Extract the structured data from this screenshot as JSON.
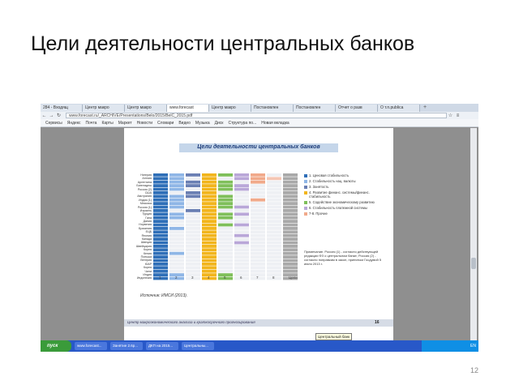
{
  "slide": {
    "title": "Цели деятельности центральных банков",
    "number": "12"
  },
  "browser": {
    "tabs": [
      "284 - Входящ",
      "Центр макро",
      "Центр макро",
      "www.forecast",
      "Центр макро",
      "Постановлен",
      "Постановлен",
      "Отчет о разв",
      "О т.п.publica"
    ],
    "active_tab": 3,
    "address": "www.forecast.ru/_ARCHIVE/Presentations/Belo/2015/BelC_2015.pdf",
    "bookmarks": [
      "Сервисы",
      "Яндекс",
      "Почта",
      "Карты",
      "Маркет",
      "Новости",
      "Словари",
      "Видео",
      "Музыка",
      "Диск",
      "Структура по...",
      "Новая вкладка"
    ]
  },
  "pdf": {
    "heading": "Цели деятельности центральных банков",
    "countries": [
      "Нигерия",
      "Англия",
      "Аргентина",
      "Бангладеш",
      "Россия (2)",
      "США",
      "Австралия",
      "Индия (1)",
      "Мексика",
      "Россия (1)",
      "Израиль",
      "Турция",
      "Гана",
      "Дания",
      "Норвегия",
      "Бразилия",
      "ЕЦБ",
      "Япония",
      "Канада",
      "Швеция",
      "Швейцария",
      "Корея",
      "Кения",
      "Польша",
      "Венгрия",
      "ЮАР",
      "Корея",
      "Чили",
      "Индия",
      "Индонезия"
    ],
    "column_numbers": [
      "1",
      "2",
      "3",
      "4",
      "5",
      "6",
      "7",
      "8",
      "Цели"
    ],
    "legend": [
      {
        "label": "1. Ценовая стабильность",
        "color": "#2f6fb8"
      },
      {
        "label": "2. Стабильность нац. валюты",
        "color": "#8fb6e6"
      },
      {
        "label": "3. Занятость",
        "color": "#6a7fb3"
      },
      {
        "label": "4. Развитие финанс. системы/финанс. стабильность",
        "color": "#f2b51c"
      },
      {
        "label": "5. Содействие экономическому развитию",
        "color": "#7fbf5a"
      },
      {
        "label": "6. Стабильность платежной системы",
        "color": "#b9a7d8"
      },
      {
        "label": "7-8. Прочие",
        "color": "#f1a98a"
      }
    ],
    "note": "Примечание. Россия (1) - согласно действующей редакции ФЗ о центральном банке; Россия (2) - согласно поправкам в закон, принятым Госдумой 5 июля 2013 г.",
    "source": "Источник: ИМСИ (2013).",
    "footer": "Центр макроэкономического анализа и краткосрочного прогнозирования",
    "page": "16",
    "tooltip": "Центральный банк"
  },
  "taskbar": {
    "start": "пуск",
    "tasks": [
      "www.forecast...",
      "Занятие 2.6р...",
      "ДКП на 2015...",
      "Центральны..."
    ],
    "clock": "EN"
  },
  "chart_data": {
    "type": "heatmap",
    "rows": [
      "Нигерия",
      "Англия",
      "Аргентина",
      "Бангладеш",
      "Россия (2)",
      "США",
      "Австралия",
      "Индия (1)",
      "Мексика",
      "Россия (1)",
      "Израиль",
      "Турция",
      "Гана",
      "Дания",
      "Норвегия",
      "Бразилия",
      "ЕЦБ",
      "Япония",
      "Канада",
      "Швеция",
      "Швейцария",
      "Корея",
      "Кения",
      "Польша",
      "Венгрия",
      "ЮАР",
      "Корея",
      "Чили",
      "Индия",
      "Индонезия"
    ],
    "columns": [
      "1",
      "2",
      "3",
      "4",
      "5",
      "6",
      "7",
      "8",
      "Цели"
    ],
    "colors": [
      "#2f6fb8",
      "#8fb6e6",
      "#6a7fb3",
      "#f2b51c",
      "#7fbf5a",
      "#b9a7d8",
      "#f1a98a",
      "#f5c6b3",
      "#a9a9a9"
    ],
    "active": [
      [
        1,
        1,
        1,
        1,
        1,
        1,
        1,
        0,
        1
      ],
      [
        1,
        1,
        0,
        1,
        0,
        1,
        1,
        1,
        1
      ],
      [
        1,
        1,
        1,
        1,
        1,
        0,
        1,
        0,
        1
      ],
      [
        1,
        1,
        1,
        1,
        1,
        1,
        0,
        0,
        1
      ],
      [
        1,
        1,
        0,
        1,
        1,
        1,
        0,
        0,
        1
      ],
      [
        1,
        0,
        1,
        1,
        0,
        0,
        0,
        0,
        1
      ],
      [
        1,
        1,
        1,
        1,
        1,
        0,
        0,
        0,
        1
      ],
      [
        1,
        1,
        0,
        1,
        1,
        0,
        1,
        0,
        1
      ],
      [
        1,
        1,
        0,
        1,
        1,
        0,
        0,
        0,
        1
      ],
      [
        1,
        1,
        0,
        1,
        1,
        1,
        0,
        0,
        1
      ],
      [
        1,
        0,
        1,
        1,
        0,
        0,
        0,
        0,
        1
      ],
      [
        1,
        1,
        0,
        1,
        1,
        1,
        0,
        0,
        1
      ],
      [
        1,
        1,
        0,
        1,
        1,
        0,
        0,
        0,
        1
      ],
      [
        1,
        0,
        0,
        1,
        0,
        0,
        0,
        0,
        1
      ],
      [
        1,
        0,
        0,
        1,
        1,
        1,
        0,
        0,
        1
      ],
      [
        1,
        1,
        0,
        1,
        0,
        0,
        0,
        0,
        1
      ],
      [
        1,
        0,
        0,
        1,
        0,
        0,
        0,
        0,
        1
      ],
      [
        1,
        0,
        0,
        1,
        0,
        1,
        0,
        0,
        1
      ],
      [
        1,
        0,
        0,
        1,
        0,
        0,
        0,
        0,
        1
      ],
      [
        1,
        0,
        0,
        1,
        0,
        1,
        0,
        0,
        1
      ],
      [
        1,
        0,
        0,
        1,
        0,
        0,
        0,
        0,
        1
      ],
      [
        1,
        0,
        0,
        1,
        0,
        0,
        0,
        0,
        1
      ],
      [
        1,
        1,
        0,
        1,
        0,
        0,
        0,
        0,
        1
      ],
      [
        1,
        0,
        0,
        1,
        0,
        0,
        0,
        0,
        1
      ],
      [
        1,
        0,
        0,
        1,
        0,
        0,
        0,
        0,
        1
      ],
      [
        1,
        0,
        0,
        1,
        0,
        0,
        0,
        0,
        1
      ],
      [
        1,
        0,
        0,
        1,
        0,
        0,
        0,
        0,
        1
      ],
      [
        1,
        0,
        0,
        1,
        0,
        0,
        0,
        0,
        1
      ],
      [
        1,
        1,
        0,
        1,
        1,
        0,
        0,
        0,
        1
      ],
      [
        1,
        1,
        0,
        1,
        1,
        0,
        0,
        0,
        1
      ]
    ]
  }
}
